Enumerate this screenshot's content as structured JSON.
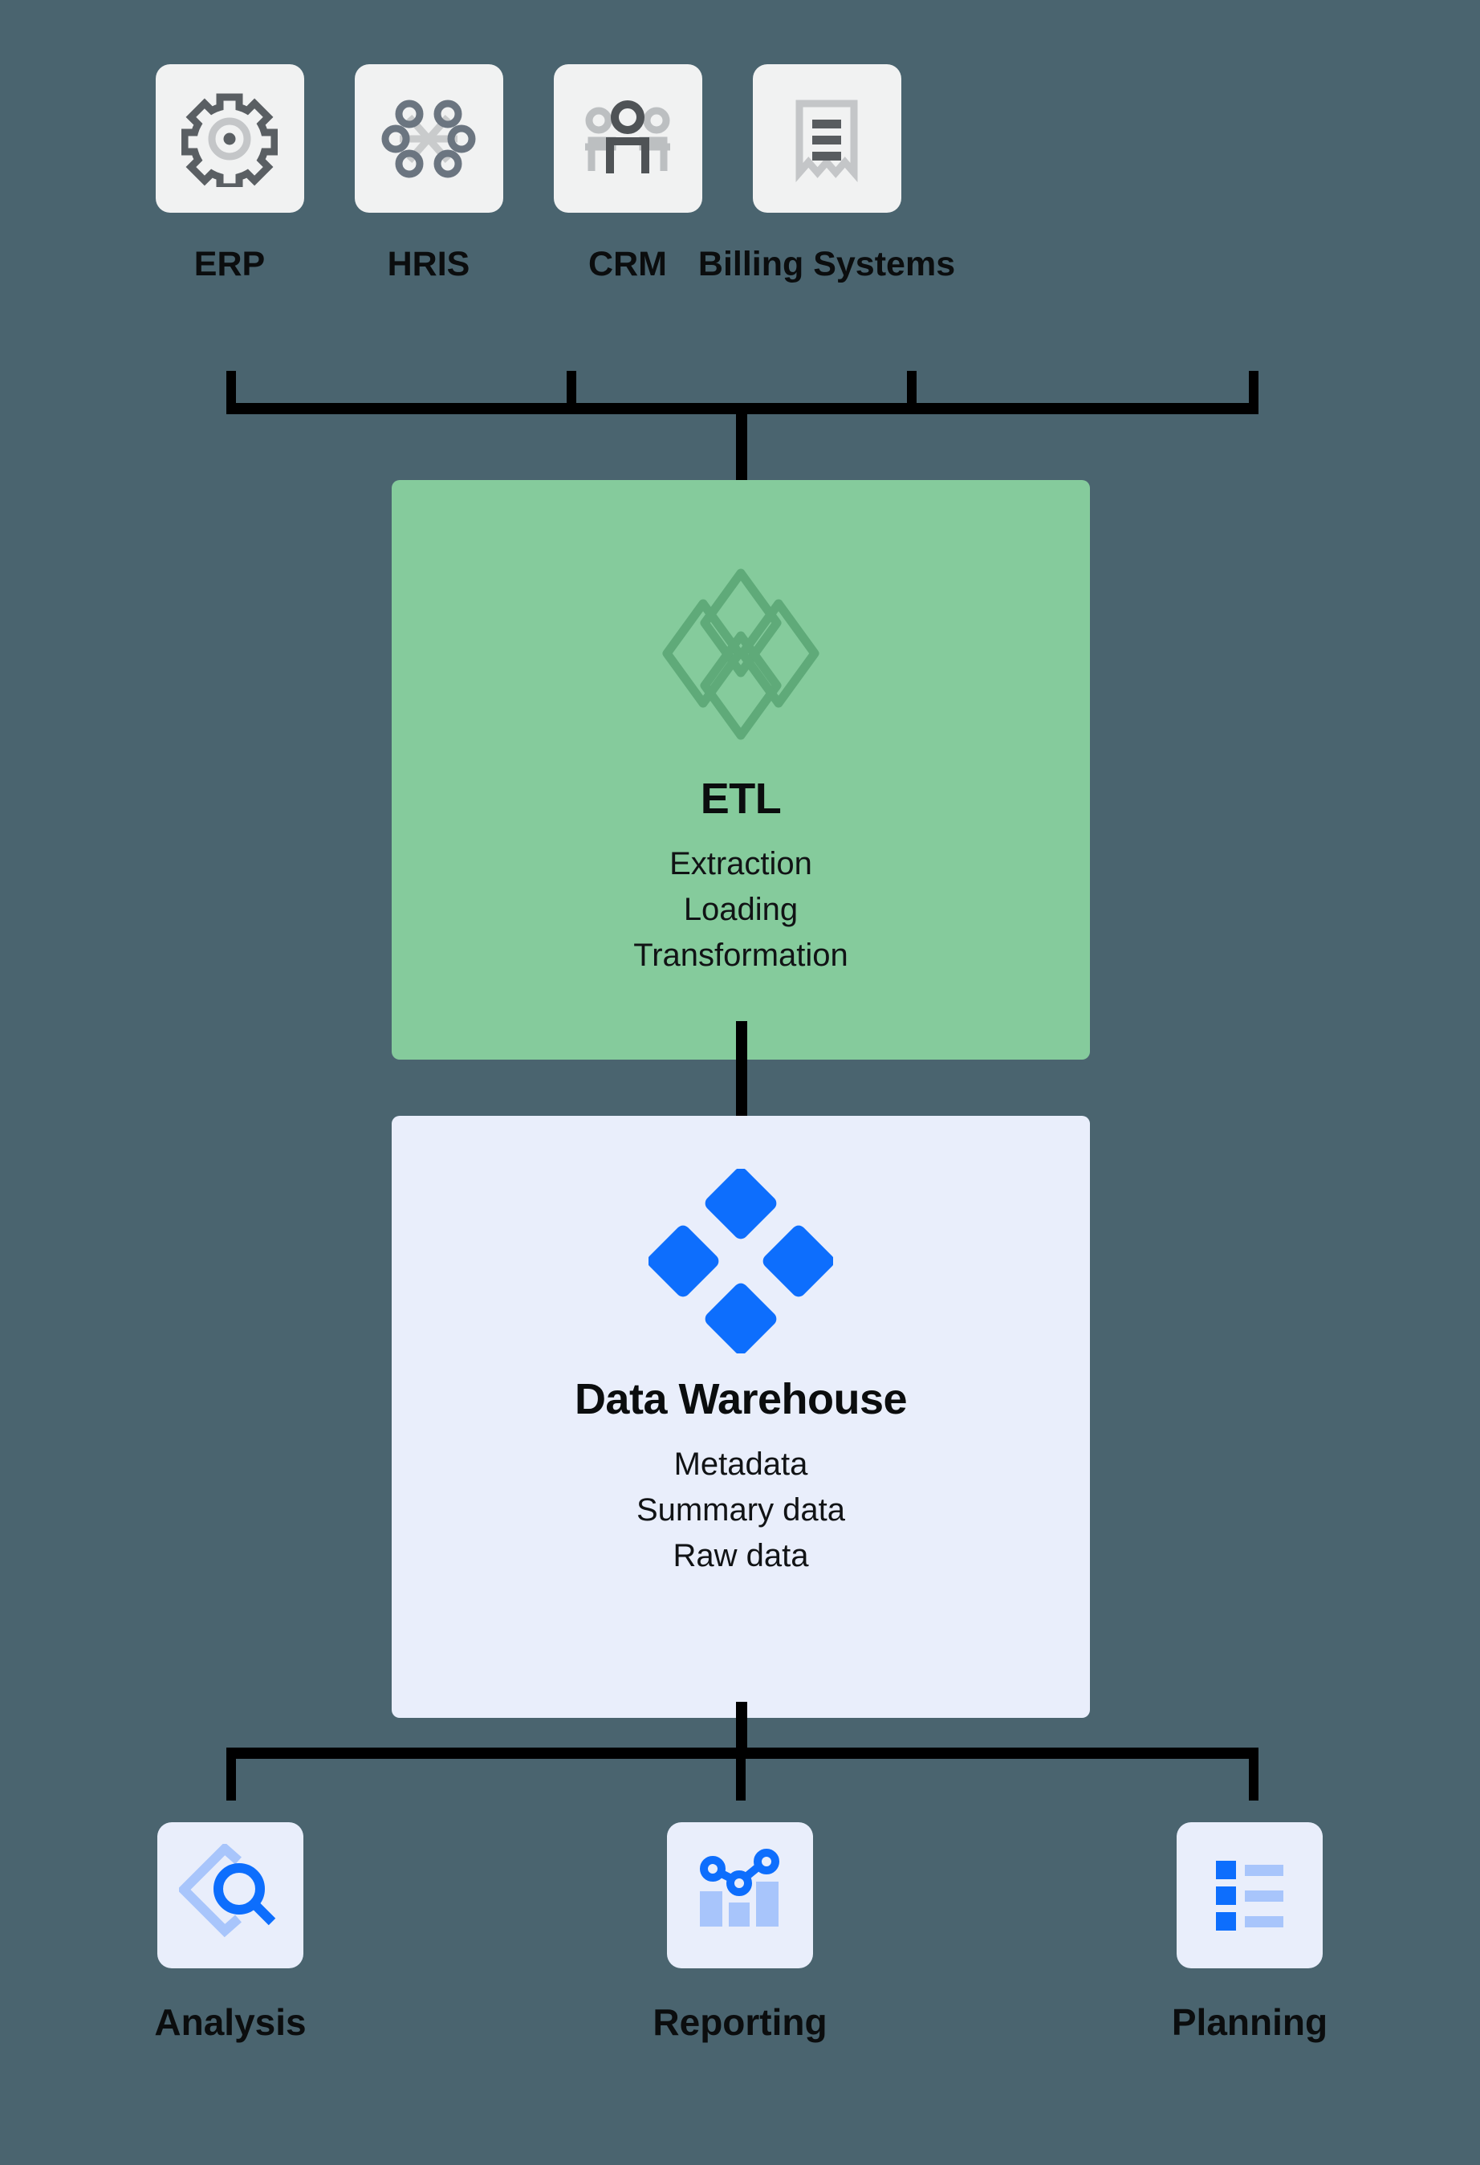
{
  "theme": {
    "background": "#4a646f",
    "connector": "#000000",
    "source_tile_bg": "#f1f2f2",
    "etl_bg": "#85cb9c",
    "etl_icon_stroke": "#5faa79",
    "warehouse_bg": "#e9eefb",
    "accent_blue": "#0d6efd",
    "accent_blue_light": "#a8c5fb",
    "icon_gray_dark": "#5a5f63",
    "icon_gray_mid": "#6b7580",
    "icon_gray_light": "#c4c6c8"
  },
  "sources": {
    "items": [
      {
        "label": "ERP",
        "icon": "gear-icon"
      },
      {
        "label": "HRIS",
        "icon": "network-nodes-icon"
      },
      {
        "label": "CRM",
        "icon": "people-group-icon"
      },
      {
        "label": "Billing Systems",
        "icon": "receipt-icon"
      }
    ]
  },
  "etl": {
    "icon": "four-diamonds-outline-icon",
    "title": "ETL",
    "lines": [
      "Extraction",
      "Loading",
      "Transformation"
    ]
  },
  "warehouse": {
    "icon": "four-diamonds-solid-icon",
    "title": "Data Warehouse",
    "lines": [
      "Metadata",
      "Summary data",
      "Raw data"
    ]
  },
  "outputs": {
    "items": [
      {
        "label": "Analysis",
        "icon": "diamond-magnifier-icon"
      },
      {
        "label": "Reporting",
        "icon": "bar-line-chart-icon"
      },
      {
        "label": "Planning",
        "icon": "checklist-icon"
      }
    ]
  }
}
